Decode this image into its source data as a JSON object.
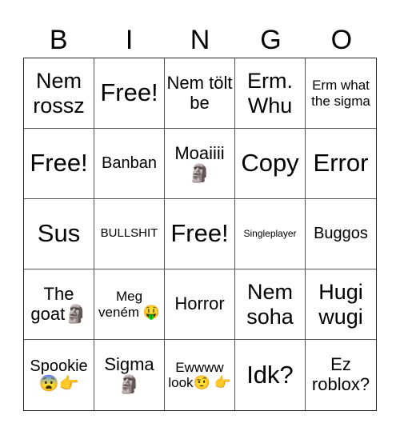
{
  "header": [
    "B",
    "I",
    "N",
    "G",
    "O"
  ],
  "cells": [
    {
      "text": "Nem rossz",
      "size": "s-l"
    },
    {
      "text": "Free!",
      "size": "s-xl"
    },
    {
      "text": "Nem tölt be",
      "size": "s-m"
    },
    {
      "text": "Erm. Whu",
      "size": "s-l"
    },
    {
      "text": "Erm what the sigma",
      "size": "s-s"
    },
    {
      "text": "Free!",
      "size": "s-xl"
    },
    {
      "text": "Banban",
      "size": "s-ms"
    },
    {
      "text": "Moaiiii 🗿",
      "size": "s-m"
    },
    {
      "text": "Copy",
      "size": "s-xl"
    },
    {
      "text": "Error",
      "size": "s-xl"
    },
    {
      "text": "Sus",
      "size": "s-xl"
    },
    {
      "text": "BULLSHIT",
      "size": "s-xs"
    },
    {
      "text": "Free!",
      "size": "s-xl"
    },
    {
      "text": "Singleplayer",
      "size": "s-xxs"
    },
    {
      "text": "Buggos",
      "size": "s-ms"
    },
    {
      "text": "The goat🗿",
      "size": "s-m"
    },
    {
      "text": "Meg veném 🤑",
      "size": "s-s"
    },
    {
      "text": "Horror",
      "size": "s-m"
    },
    {
      "text": "Nem soha",
      "size": "s-l"
    },
    {
      "text": "Hugi wugi",
      "size": "s-l"
    },
    {
      "text": "Spookie 😨👉",
      "size": "s-ms"
    },
    {
      "text": "Sigma 🗿",
      "size": "s-m"
    },
    {
      "text": "Ewwww look🤨 👉",
      "size": "s-s"
    },
    {
      "text": "Idk?",
      "size": "s-xl"
    },
    {
      "text": "Ez roblox?",
      "size": "s-m"
    }
  ]
}
